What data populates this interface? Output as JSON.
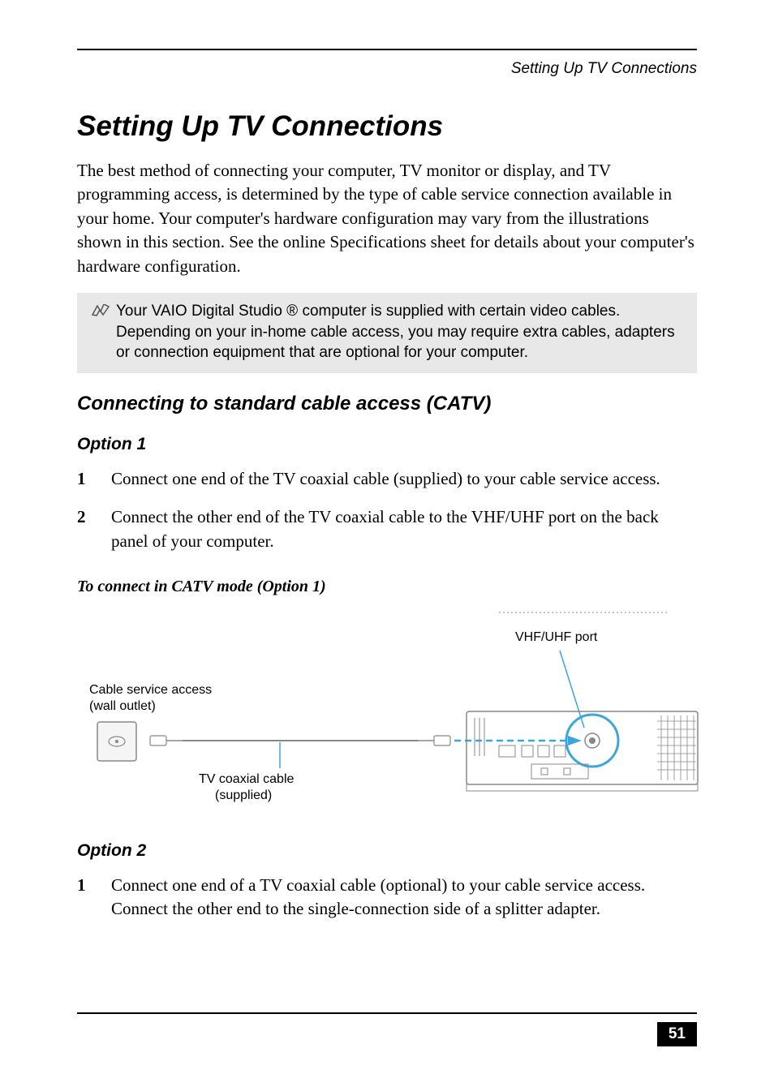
{
  "header": {
    "running_title": "Setting Up TV Connections"
  },
  "title": "Setting Up TV Connections",
  "intro": "The best method of connecting your computer, TV monitor or display, and TV programming access, is determined by the type of cable service connection available in your home. Your computer's hardware configuration may vary from the illustrations shown in this section. See the online Specifications sheet for details about your computer's hardware configuration.",
  "note": "Your VAIO Digital Studio ® computer is supplied with certain video cables. Depending on your in-home cable access, you may require extra cables, adapters or connection equipment that are optional for your computer.",
  "section_heading": "Connecting to standard cable access (CATV)",
  "option1": {
    "heading": "Option 1",
    "steps": [
      "Connect one end of the TV coaxial cable (supplied) to your cable service access.",
      "Connect the other end of the TV coaxial cable to the VHF/UHF port on the back panel of your computer."
    ]
  },
  "diagram": {
    "title": "To connect in CATV mode (Option 1)",
    "labels": {
      "vhf_port": "VHF/UHF port",
      "cable_access_1": "Cable service access",
      "cable_access_2": "(wall outlet)",
      "coax_1": "TV coaxial cable",
      "coax_2": "(supplied)"
    }
  },
  "option2": {
    "heading": "Option 2",
    "steps": [
      "Connect one end of a TV coaxial cable (optional) to your cable service access. Connect the other end to the single-connection side of a splitter adapter."
    ]
  },
  "page_number": "51"
}
